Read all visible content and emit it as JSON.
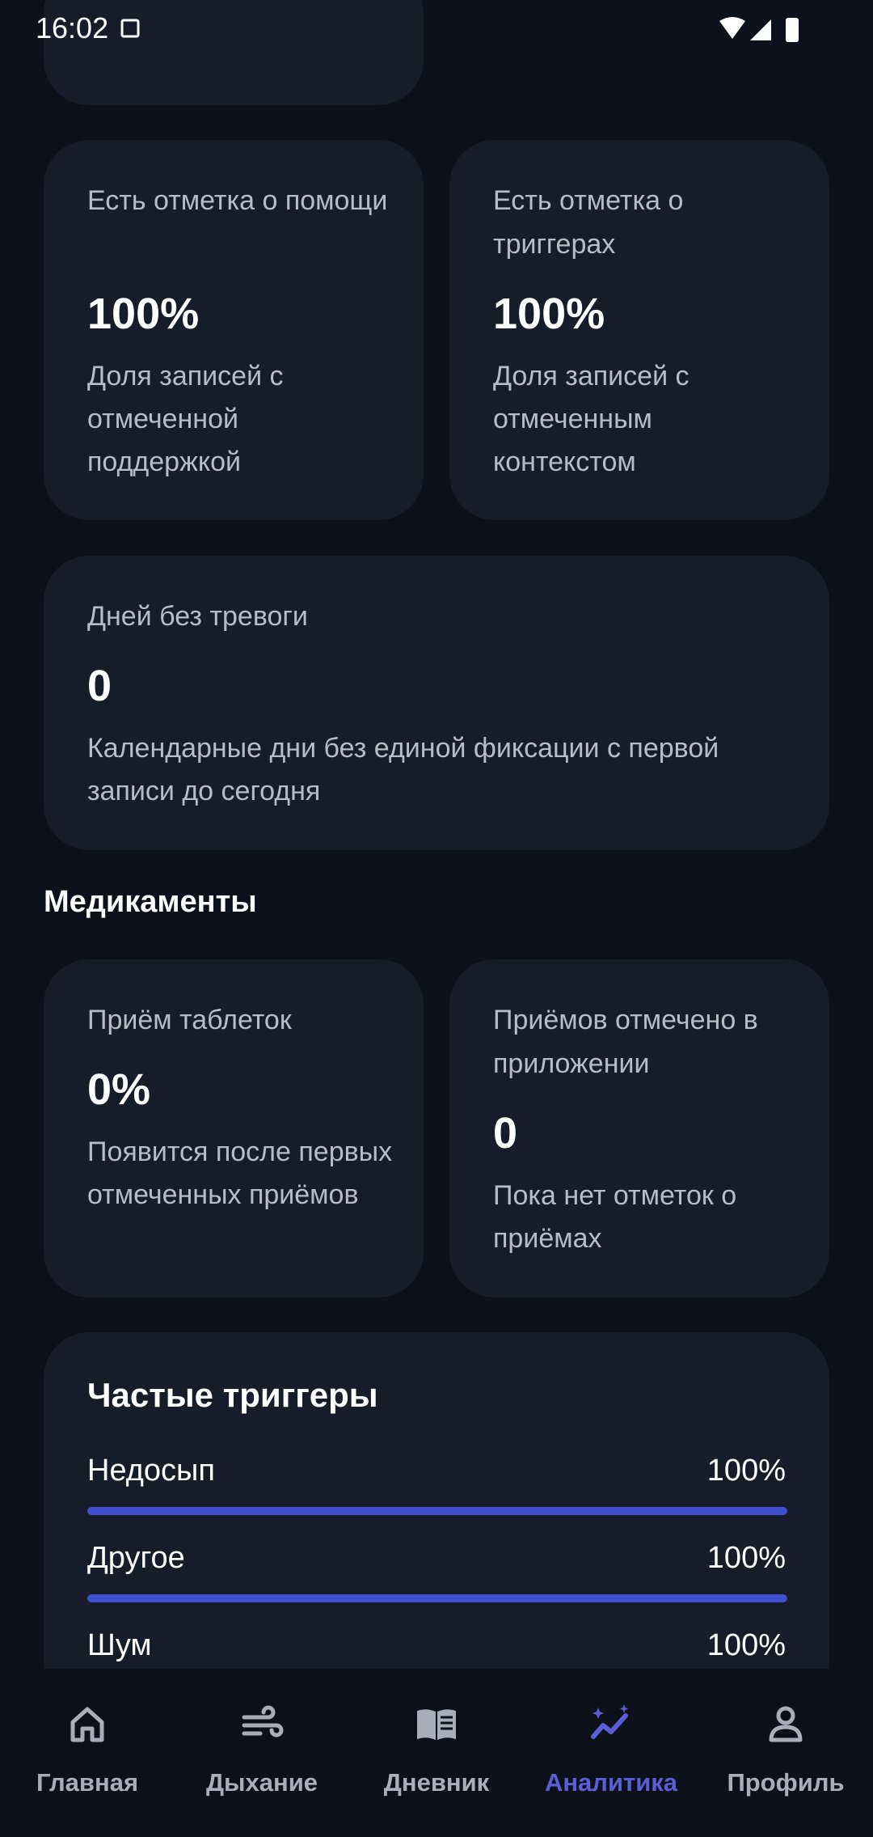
{
  "status_bar": {
    "time": "16:02"
  },
  "cards": {
    "help": {
      "title": "Есть отметка о помощи",
      "value": "100%",
      "description": "Доля записей с отмеченной поддержкой"
    },
    "triggers_mark": {
      "title": "Есть отметка о триггерах",
      "value": "100%",
      "description": "Доля записей с отмеченным контекстом"
    },
    "calm_days": {
      "title": "Дней без тревоги",
      "value": "0",
      "description": "Календарные дни без единой фиксации с первой записи до сегодня"
    }
  },
  "medications": {
    "section_title": "Медикаменты",
    "pills": {
      "title": "Приём таблеток",
      "value": "0%",
      "description": "Появится после первых отмеченных приёмов"
    },
    "logged": {
      "title": "Приёмов отмечено в приложении",
      "value": "0",
      "description": "Пока нет отметок о приёмах"
    }
  },
  "frequent_triggers": {
    "title": "Частые триггеры",
    "items": [
      {
        "label": "Недосып",
        "value": "100%",
        "fraction": 1.0
      },
      {
        "label": "Другое",
        "value": "100%",
        "fraction": 1.0
      },
      {
        "label": "Шум",
        "value": "100%",
        "fraction": 1.0
      }
    ]
  },
  "nav": {
    "items": [
      {
        "label": "Главная",
        "icon": "home-icon"
      },
      {
        "label": "Дыхание",
        "icon": "wind-icon"
      },
      {
        "label": "Дневник",
        "icon": "book-icon"
      },
      {
        "label": "Аналитика",
        "icon": "analytics-icon"
      },
      {
        "label": "Профиль",
        "icon": "profile-icon"
      }
    ],
    "active_index": 3
  },
  "colors": {
    "background": "#0b101a",
    "card": "#171c2a",
    "accent": "#5a5fd6",
    "bar": "#3f4fcf"
  }
}
